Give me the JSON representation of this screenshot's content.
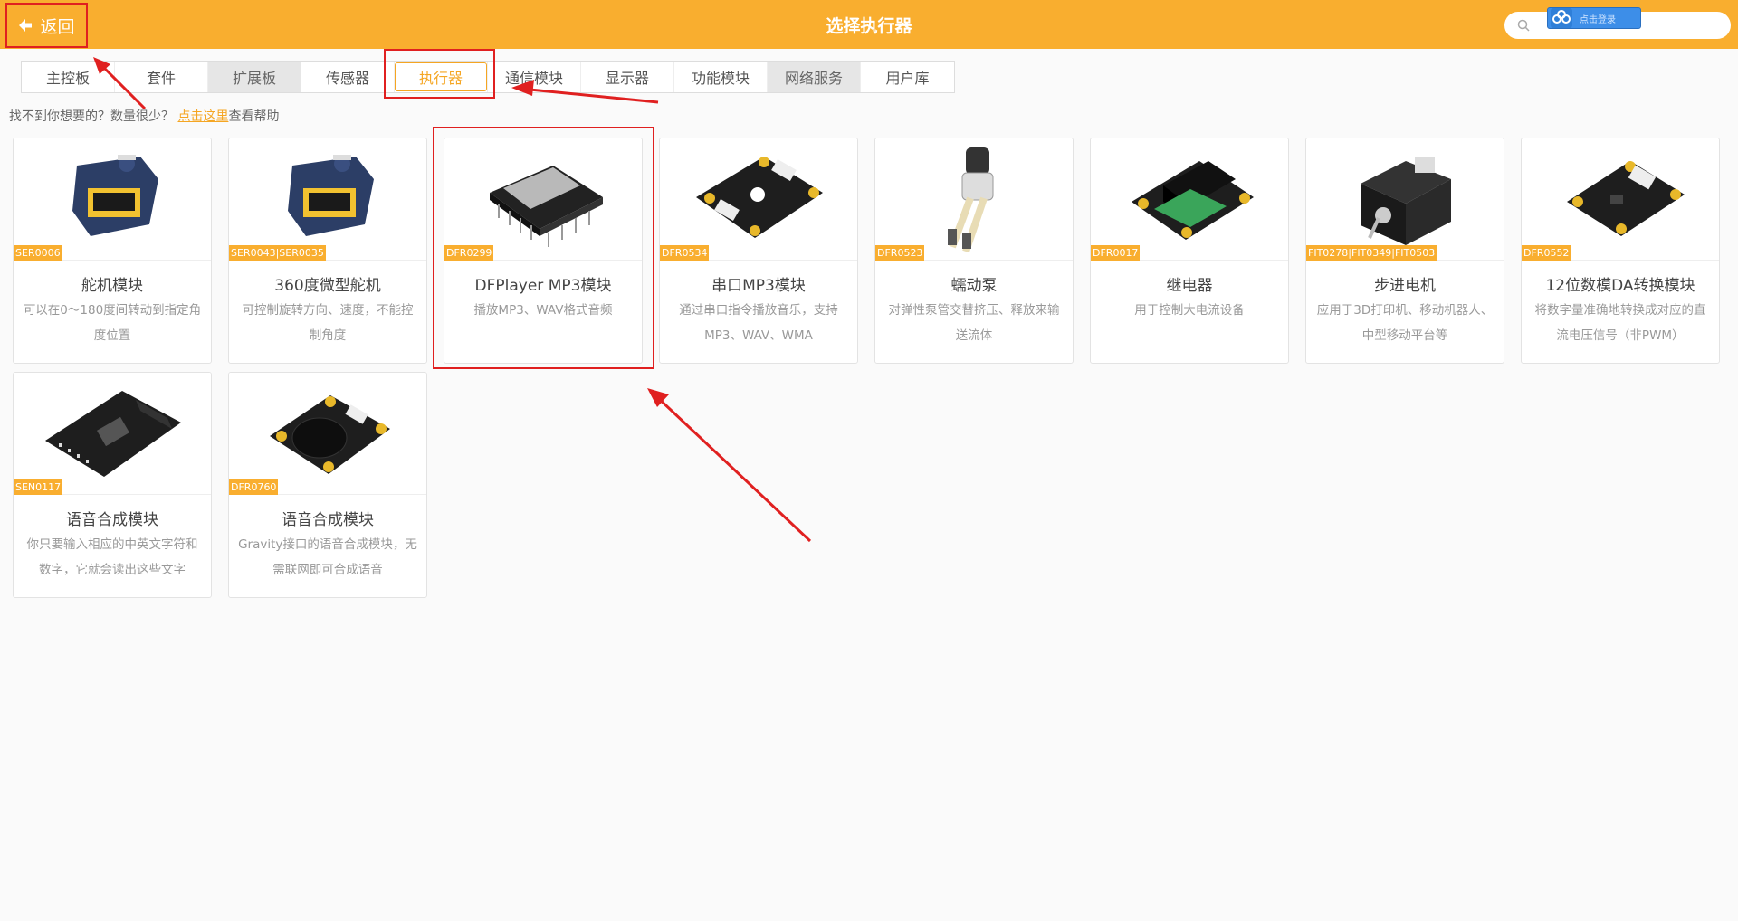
{
  "header": {
    "back_label": "返回",
    "title": "选择执行器",
    "login_label": "点击登录",
    "brand_color": "#f9ae2f"
  },
  "tabs": [
    {
      "label": "主控板",
      "style": "normal"
    },
    {
      "label": "套件",
      "style": "normal"
    },
    {
      "label": "扩展板",
      "style": "grey"
    },
    {
      "label": "传感器",
      "style": "normal"
    },
    {
      "label": "执行器",
      "style": "active"
    },
    {
      "label": "通信模块",
      "style": "normal"
    },
    {
      "label": "显示器",
      "style": "normal"
    },
    {
      "label": "功能模块",
      "style": "normal"
    },
    {
      "label": "网络服务",
      "style": "grey"
    },
    {
      "label": "用户库",
      "style": "normal"
    }
  ],
  "help": {
    "prefix": "找不到你想要的？数量很少？",
    "link": "点击这里",
    "suffix": "查看帮助"
  },
  "cards": [
    {
      "code": "SER0006",
      "title": "舵机模块",
      "desc": "可以在0～180度间转动到指定角度位置",
      "icon": "servo-image"
    },
    {
      "code": "SER0043|SER0035",
      "title": "360度微型舵机",
      "desc": "可控制旋转方向、速度，不能控制角度",
      "icon": "servo-image"
    },
    {
      "code": "DFR0299",
      "title": "DFPlayer MP3模块",
      "desc": "播放MP3、WAV格式音频",
      "icon": "mp3-module-image"
    },
    {
      "code": "DFR0534",
      "title": "串口MP3模块",
      "desc": "通过串口指令播放音乐，支持MP3、WAV、WMA",
      "icon": "board-image"
    },
    {
      "code": "DFR0523",
      "title": "蠕动泵",
      "desc": "对弹性泵管交替挤压、释放来输送流体",
      "icon": "pump-image"
    },
    {
      "code": "DFR0017",
      "title": "继电器",
      "desc": "用于控制大电流设备",
      "icon": "relay-image"
    },
    {
      "code": "FIT0278|FIT0349|FIT0503",
      "title": "步进电机",
      "desc": "应用于3D打印机、移动机器人、中型移动平台等",
      "icon": "stepper-image"
    },
    {
      "code": "DFR0552",
      "title": "12位数模DA转换模块",
      "desc": "将数字量准确地转换成对应的直流电压信号（非PWM）",
      "icon": "board-image"
    },
    {
      "code": "SEN0117",
      "title": "语音合成模块",
      "desc": "你只要输入相应的中英文字符和数字，它就会读出这些文字",
      "icon": "speech-board-image"
    },
    {
      "code": "DFR0760",
      "title": "语音合成模块",
      "desc": "Gravity接口的语音合成模块，无需联网即可合成语音",
      "icon": "speaker-board-image"
    }
  ]
}
